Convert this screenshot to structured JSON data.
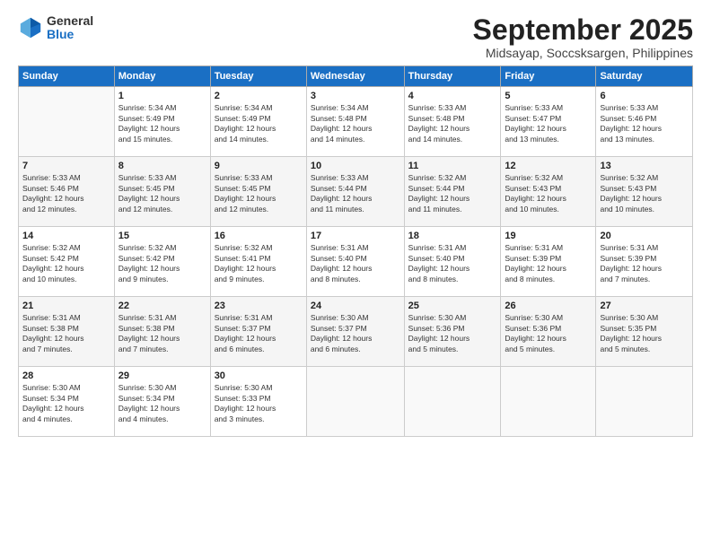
{
  "logo": {
    "general": "General",
    "blue": "Blue"
  },
  "header": {
    "month": "September 2025",
    "location": "Midsayap, Soccsksargen, Philippines"
  },
  "weekdays": [
    "Sunday",
    "Monday",
    "Tuesday",
    "Wednesday",
    "Thursday",
    "Friday",
    "Saturday"
  ],
  "weeks": [
    [
      {
        "day": "",
        "info": ""
      },
      {
        "day": "1",
        "info": "Sunrise: 5:34 AM\nSunset: 5:49 PM\nDaylight: 12 hours\nand 15 minutes."
      },
      {
        "day": "2",
        "info": "Sunrise: 5:34 AM\nSunset: 5:49 PM\nDaylight: 12 hours\nand 14 minutes."
      },
      {
        "day": "3",
        "info": "Sunrise: 5:34 AM\nSunset: 5:48 PM\nDaylight: 12 hours\nand 14 minutes."
      },
      {
        "day": "4",
        "info": "Sunrise: 5:33 AM\nSunset: 5:48 PM\nDaylight: 12 hours\nand 14 minutes."
      },
      {
        "day": "5",
        "info": "Sunrise: 5:33 AM\nSunset: 5:47 PM\nDaylight: 12 hours\nand 13 minutes."
      },
      {
        "day": "6",
        "info": "Sunrise: 5:33 AM\nSunset: 5:46 PM\nDaylight: 12 hours\nand 13 minutes."
      }
    ],
    [
      {
        "day": "7",
        "info": "Sunrise: 5:33 AM\nSunset: 5:46 PM\nDaylight: 12 hours\nand 12 minutes."
      },
      {
        "day": "8",
        "info": "Sunrise: 5:33 AM\nSunset: 5:45 PM\nDaylight: 12 hours\nand 12 minutes."
      },
      {
        "day": "9",
        "info": "Sunrise: 5:33 AM\nSunset: 5:45 PM\nDaylight: 12 hours\nand 12 minutes."
      },
      {
        "day": "10",
        "info": "Sunrise: 5:33 AM\nSunset: 5:44 PM\nDaylight: 12 hours\nand 11 minutes."
      },
      {
        "day": "11",
        "info": "Sunrise: 5:32 AM\nSunset: 5:44 PM\nDaylight: 12 hours\nand 11 minutes."
      },
      {
        "day": "12",
        "info": "Sunrise: 5:32 AM\nSunset: 5:43 PM\nDaylight: 12 hours\nand 10 minutes."
      },
      {
        "day": "13",
        "info": "Sunrise: 5:32 AM\nSunset: 5:43 PM\nDaylight: 12 hours\nand 10 minutes."
      }
    ],
    [
      {
        "day": "14",
        "info": "Sunrise: 5:32 AM\nSunset: 5:42 PM\nDaylight: 12 hours\nand 10 minutes."
      },
      {
        "day": "15",
        "info": "Sunrise: 5:32 AM\nSunset: 5:42 PM\nDaylight: 12 hours\nand 9 minutes."
      },
      {
        "day": "16",
        "info": "Sunrise: 5:32 AM\nSunset: 5:41 PM\nDaylight: 12 hours\nand 9 minutes."
      },
      {
        "day": "17",
        "info": "Sunrise: 5:31 AM\nSunset: 5:40 PM\nDaylight: 12 hours\nand 8 minutes."
      },
      {
        "day": "18",
        "info": "Sunrise: 5:31 AM\nSunset: 5:40 PM\nDaylight: 12 hours\nand 8 minutes."
      },
      {
        "day": "19",
        "info": "Sunrise: 5:31 AM\nSunset: 5:39 PM\nDaylight: 12 hours\nand 8 minutes."
      },
      {
        "day": "20",
        "info": "Sunrise: 5:31 AM\nSunset: 5:39 PM\nDaylight: 12 hours\nand 7 minutes."
      }
    ],
    [
      {
        "day": "21",
        "info": "Sunrise: 5:31 AM\nSunset: 5:38 PM\nDaylight: 12 hours\nand 7 minutes."
      },
      {
        "day": "22",
        "info": "Sunrise: 5:31 AM\nSunset: 5:38 PM\nDaylight: 12 hours\nand 7 minutes."
      },
      {
        "day": "23",
        "info": "Sunrise: 5:31 AM\nSunset: 5:37 PM\nDaylight: 12 hours\nand 6 minutes."
      },
      {
        "day": "24",
        "info": "Sunrise: 5:30 AM\nSunset: 5:37 PM\nDaylight: 12 hours\nand 6 minutes."
      },
      {
        "day": "25",
        "info": "Sunrise: 5:30 AM\nSunset: 5:36 PM\nDaylight: 12 hours\nand 5 minutes."
      },
      {
        "day": "26",
        "info": "Sunrise: 5:30 AM\nSunset: 5:36 PM\nDaylight: 12 hours\nand 5 minutes."
      },
      {
        "day": "27",
        "info": "Sunrise: 5:30 AM\nSunset: 5:35 PM\nDaylight: 12 hours\nand 5 minutes."
      }
    ],
    [
      {
        "day": "28",
        "info": "Sunrise: 5:30 AM\nSunset: 5:34 PM\nDaylight: 12 hours\nand 4 minutes."
      },
      {
        "day": "29",
        "info": "Sunrise: 5:30 AM\nSunset: 5:34 PM\nDaylight: 12 hours\nand 4 minutes."
      },
      {
        "day": "30",
        "info": "Sunrise: 5:30 AM\nSunset: 5:33 PM\nDaylight: 12 hours\nand 3 minutes."
      },
      {
        "day": "",
        "info": ""
      },
      {
        "day": "",
        "info": ""
      },
      {
        "day": "",
        "info": ""
      },
      {
        "day": "",
        "info": ""
      }
    ]
  ]
}
